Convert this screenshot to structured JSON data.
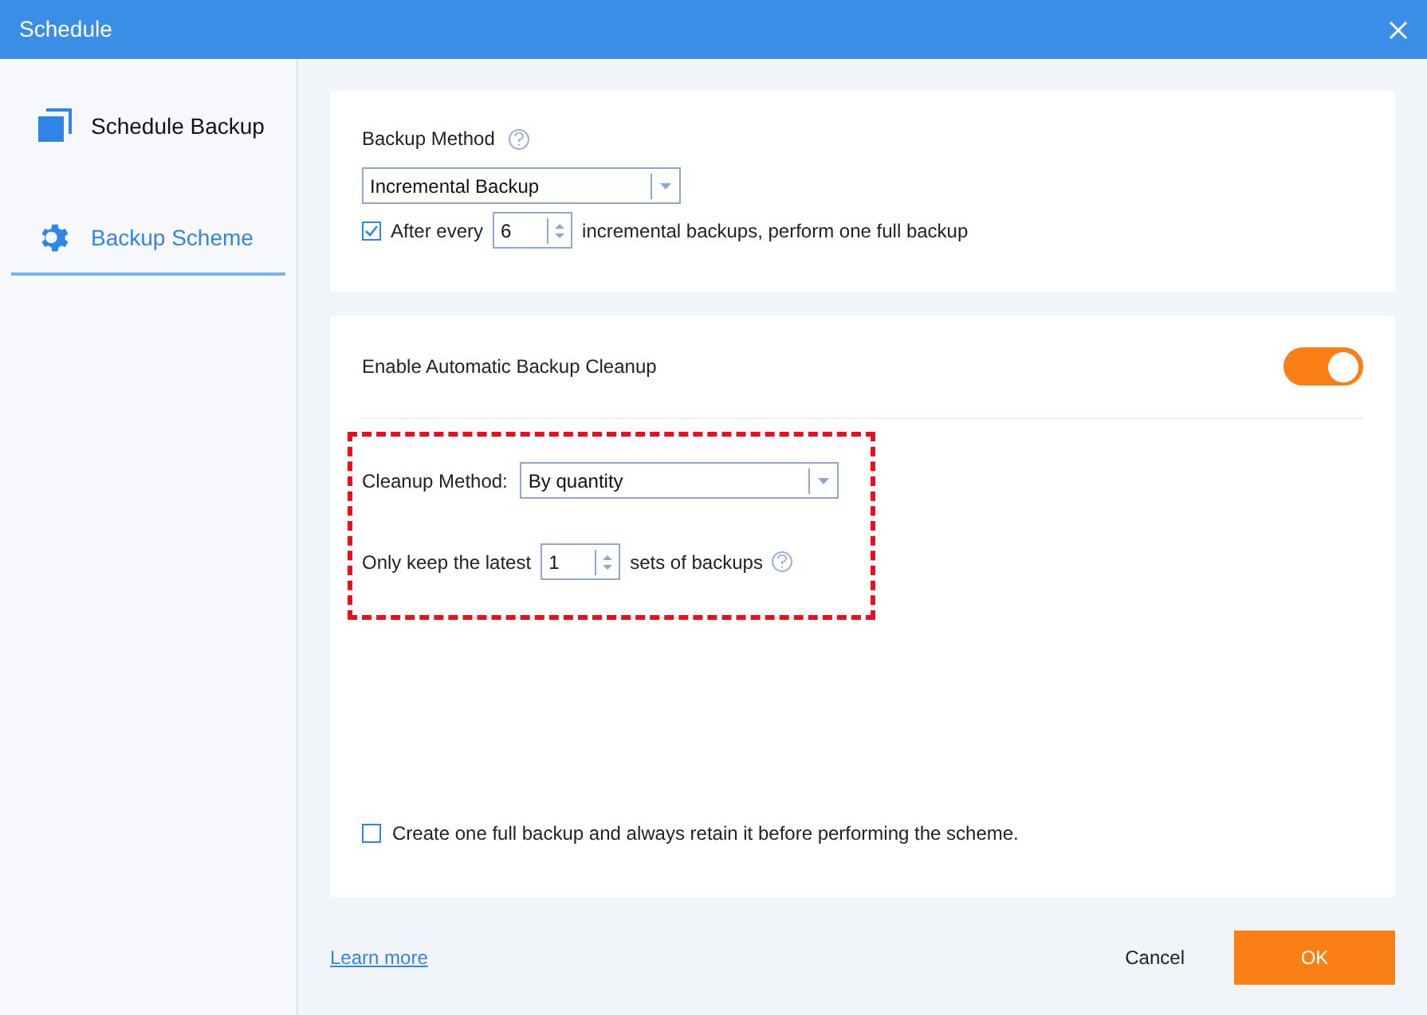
{
  "window": {
    "title": "Schedule"
  },
  "sidebar": {
    "items": [
      {
        "label": "Schedule Backup",
        "selected": false,
        "kind": "copy"
      },
      {
        "label": "Backup Scheme",
        "selected": true,
        "kind": "gear"
      }
    ]
  },
  "backup_method": {
    "label": "Backup Method",
    "value": "Incremental Backup",
    "full_backup": {
      "checked": true,
      "before": "After every",
      "value": "6",
      "after": "incremental backups, perform one full backup"
    }
  },
  "cleanup": {
    "label": "Enable Automatic Backup Cleanup",
    "on": true,
    "method_label": "Cleanup Method:",
    "method_value": "By quantity",
    "keep_before": "Only keep the latest",
    "keep_value": "1",
    "keep_after": "sets of backups"
  },
  "retain": {
    "checked": false,
    "label": "Create one full backup and always retain it before performing the scheme."
  },
  "footer": {
    "link": "Learn more",
    "cancel": "Cancel",
    "ok": "OK"
  }
}
